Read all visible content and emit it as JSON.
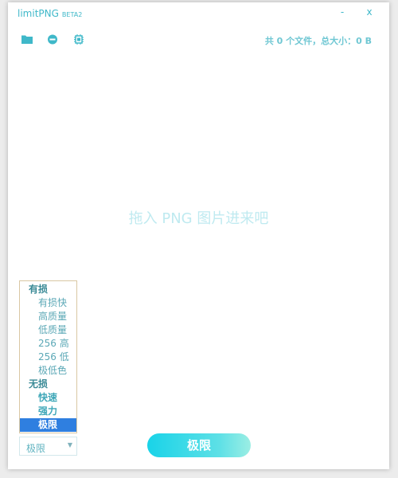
{
  "titlebar": {
    "app_name": "limitPNG",
    "version": "BETA2",
    "minimize_label": "-",
    "close_label": "x"
  },
  "toolbar": {
    "icons": [
      "folder-icon",
      "minus-circle-icon",
      "chip-icon"
    ],
    "file_summary": "共 0 个文件，总大小：0 B"
  },
  "drop_zone": {
    "hint": "拖入 PNG 图片进来吧"
  },
  "quality_list": {
    "lossy_group": "有损",
    "lossy_options": [
      "有损快",
      "高质量",
      "低质量",
      "256 高",
      "256 低",
      "极低色"
    ],
    "lossless_group": "无损",
    "lossless_options": [
      "快速",
      "强力",
      "极限"
    ],
    "selected": "极限"
  },
  "quality_select": {
    "value": "极限",
    "arrow": "▼"
  },
  "go_button": {
    "label": "极限"
  },
  "colors": {
    "accent": "#3fb8c9",
    "selection": "#2f7fe0",
    "button_gradient_start": "#19d3e8",
    "button_gradient_end": "#9ceee4"
  }
}
